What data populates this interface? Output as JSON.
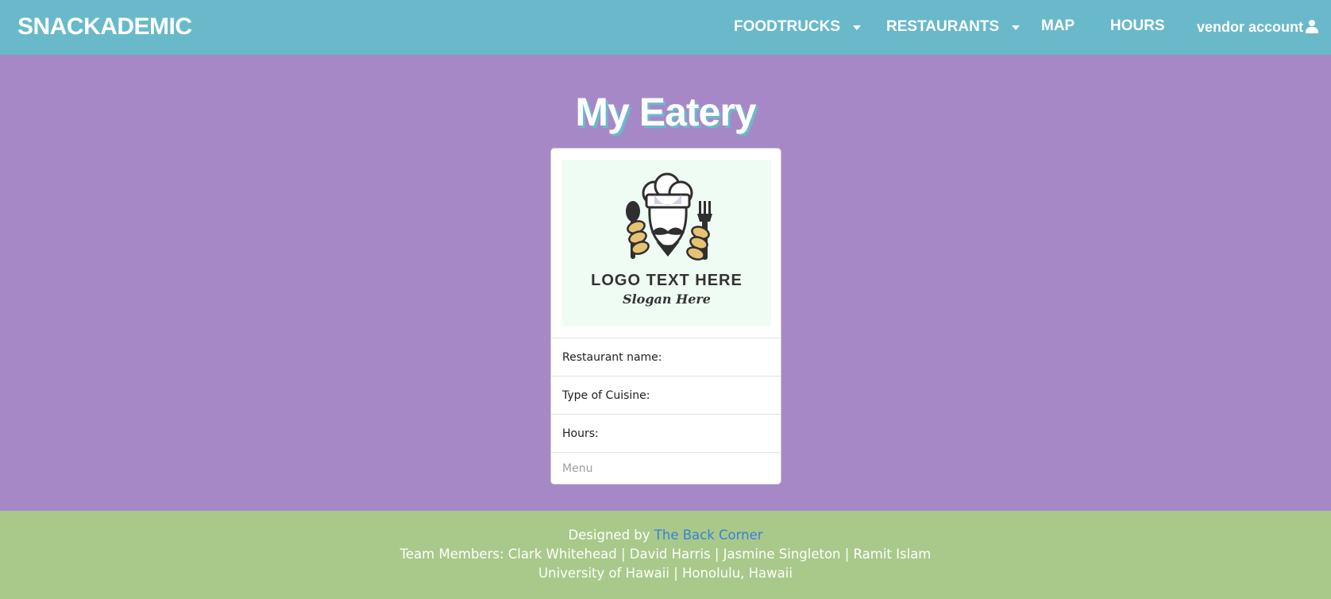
{
  "navbar": {
    "brand": "SNACKADEMIC",
    "items": [
      {
        "label": "FOODTRUCKS",
        "dropdown": true
      },
      {
        "label": "RESTAURANTS",
        "dropdown": true
      },
      {
        "label": "MAP",
        "dropdown": false
      },
      {
        "label": "HOURS",
        "dropdown": false
      }
    ],
    "account": {
      "label": "vendor account",
      "icon": "user-icon"
    }
  },
  "page": {
    "title": "My Eatery"
  },
  "card": {
    "image": {
      "logo_text": "LOGO TEXT HERE",
      "slogan": "Slogan Here",
      "icon": "chef-logo-icon"
    },
    "fields": [
      {
        "label": "Restaurant name:"
      },
      {
        "label": "Type of Cuisine:"
      },
      {
        "label": "Hours:"
      }
    ],
    "footer_label": "Menu"
  },
  "footer": {
    "designed_by_prefix": "Designed by",
    "designed_by_link": "The Back Corner",
    "team_members": "Team Members: Clark Whitehead | David Harris | Jasmine Singleton | Ramit Islam",
    "location": "University of Hawaii | Honolulu, Hawaii"
  },
  "colors": {
    "navbar": "#69b9cb",
    "background": "#a788c7",
    "footer": "#a8c98a",
    "link": "#3b7fd9"
  }
}
